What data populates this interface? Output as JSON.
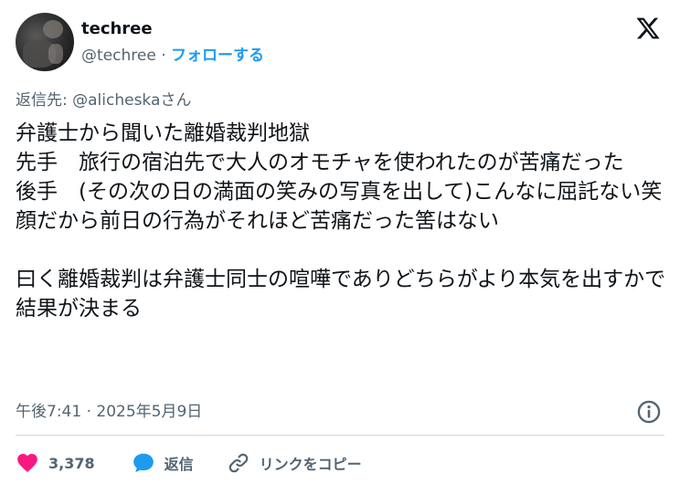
{
  "user": {
    "display_name": "techree",
    "handle": "@techree",
    "separator": "·",
    "follow_label": "フォローする"
  },
  "reply_to": "返信先: @alicheskaさん",
  "tweet_text": "弁護士から聞いた離婚裁判地獄\n先手　旅行の宿泊先で大人のオモチャを使われたのが苦痛だった\n後手　(その次の日の満面の笑みの写真を出して)こんなに屈託ない笑顔だから前日の行為がそれほど苦痛だった筈はない\n\n曰く離婚裁判は弁護士同士の喧嘩でありどちらがより本気を出すかで結果が決まる",
  "timestamp": "午後7:41 · 2025年5月9日",
  "actions": {
    "like_count": "3,378",
    "reply_label": "返信",
    "copy_link_label": "リンクをコピー"
  },
  "colors": {
    "text": "#0f1419",
    "secondary": "#536471",
    "accent": "#1d9bf0",
    "like": "#f91880",
    "divider": "#cfd9de"
  },
  "icons": [
    "x-logo-icon",
    "info-icon",
    "heart-icon",
    "reply-bubble-icon",
    "link-icon"
  ]
}
